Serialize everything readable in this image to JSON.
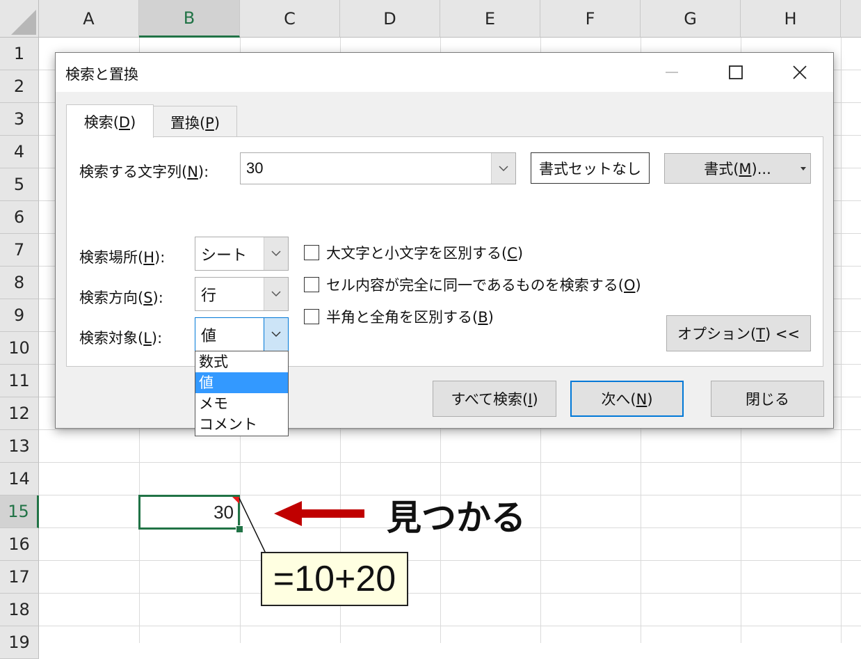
{
  "sheet": {
    "columns": [
      "A",
      "B",
      "C",
      "D",
      "E",
      "F",
      "G",
      "H"
    ],
    "rows": [
      "1",
      "2",
      "3",
      "4",
      "5",
      "6",
      "7",
      "8",
      "9",
      "10",
      "11",
      "12",
      "13",
      "14",
      "15",
      "16",
      "17",
      "18",
      "19"
    ],
    "selected_column": "B",
    "selected_row": "15",
    "cell_b15": "30",
    "accent_color": "#217346"
  },
  "annotation": {
    "found_text": "見つかる",
    "comment_text": "=10+20",
    "arrow_color": "#c00000"
  },
  "dialog": {
    "title": "検索と置換",
    "tabs": {
      "find": {
        "text": "検索(",
        "key": "D",
        "end": ")"
      },
      "replace": {
        "text": "置換(",
        "key": "P",
        "end": ")"
      }
    },
    "find_what": {
      "label": "検索する文字列(",
      "key": "N",
      "end": "):",
      "value": "30"
    },
    "format_preview": "書式セットなし",
    "format_button": {
      "text": "書式(",
      "key": "M",
      "end": ")..."
    },
    "within": {
      "label": "検索場所(",
      "key": "H",
      "end": "):",
      "value": "シート"
    },
    "search": {
      "label": "検索方向(",
      "key": "S",
      "end": "):",
      "value": "行"
    },
    "look_in": {
      "label": "検索対象(",
      "key": "L",
      "end": "):",
      "value": "値",
      "options": [
        "数式",
        "値",
        "メモ",
        "コメント"
      ]
    },
    "checkboxes": {
      "match_case": {
        "text": "大文字と小文字を区別する(",
        "key": "C",
        "end": ")",
        "checked": false
      },
      "entire_cell": {
        "text": "セル内容が完全に同一であるものを検索する(",
        "key": "O",
        "end": ")",
        "checked": false
      },
      "byte_width": {
        "text": "半角と全角を区別する(",
        "key": "B",
        "end": ")",
        "checked": false
      }
    },
    "options_button": {
      "text": "オプション(",
      "key": "T",
      "end": ") <<"
    },
    "find_all_button": {
      "text": "すべて検索(",
      "key": "I",
      "end": ")"
    },
    "find_next_button": {
      "text": "次へ(",
      "key": "N",
      "end": ")"
    },
    "close_button": "閉じる"
  }
}
